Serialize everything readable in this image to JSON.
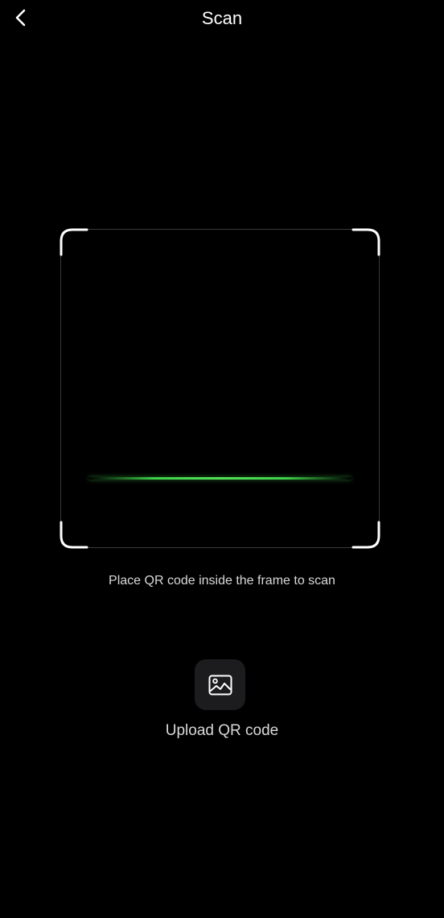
{
  "header": {
    "title": "Scan",
    "back_icon": "chevron-left-icon"
  },
  "scanner": {
    "hint": "Place QR code inside the frame to scan",
    "scan_line_color": "#3fd14a"
  },
  "upload": {
    "label": "Upload QR code",
    "icon": "image-icon"
  },
  "colors": {
    "background": "#000000",
    "text": "#ffffff",
    "secondary_text": "#d9d9d9",
    "button_background": "#1c1c1e"
  }
}
